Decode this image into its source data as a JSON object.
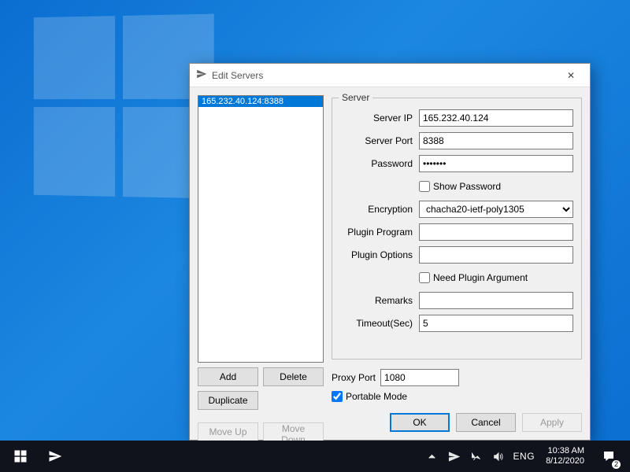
{
  "dialog": {
    "title": "Edit Servers",
    "close_glyph": "✕",
    "server_list": [
      "165.232.40.124:8388"
    ],
    "server_group_legend": "Server",
    "fields": {
      "server_ip": {
        "label": "Server IP",
        "value": "165.232.40.124"
      },
      "server_port": {
        "label": "Server Port",
        "value": "8388"
      },
      "password": {
        "label": "Password",
        "value": "•••••••"
      },
      "show_password": {
        "label": "Show Password",
        "checked": false
      },
      "encryption": {
        "label": "Encryption",
        "value": "chacha20-ietf-poly1305",
        "options": [
          "chacha20-ietf-poly1305"
        ]
      },
      "plugin_program": {
        "label": "Plugin Program",
        "value": ""
      },
      "plugin_options": {
        "label": "Plugin Options",
        "value": ""
      },
      "need_plugin_arg": {
        "label": "Need Plugin Argument",
        "checked": false
      },
      "remarks": {
        "label": "Remarks",
        "value": ""
      },
      "timeout": {
        "label": "Timeout(Sec)",
        "value": "5"
      }
    },
    "proxy_port": {
      "label": "Proxy Port",
      "value": "1080"
    },
    "portable_mode": {
      "label": "Portable Mode",
      "checked": true
    },
    "list_buttons": {
      "add": "Add",
      "delete": "Delete",
      "duplicate": "Duplicate",
      "move_up": "Move Up",
      "move_down": "Move Down"
    },
    "actions": {
      "ok": "OK",
      "cancel": "Cancel",
      "apply": "Apply"
    }
  },
  "taskbar": {
    "lang": "ENG",
    "time": "10:38 AM",
    "date": "8/12/2020",
    "notif_count": "2"
  }
}
